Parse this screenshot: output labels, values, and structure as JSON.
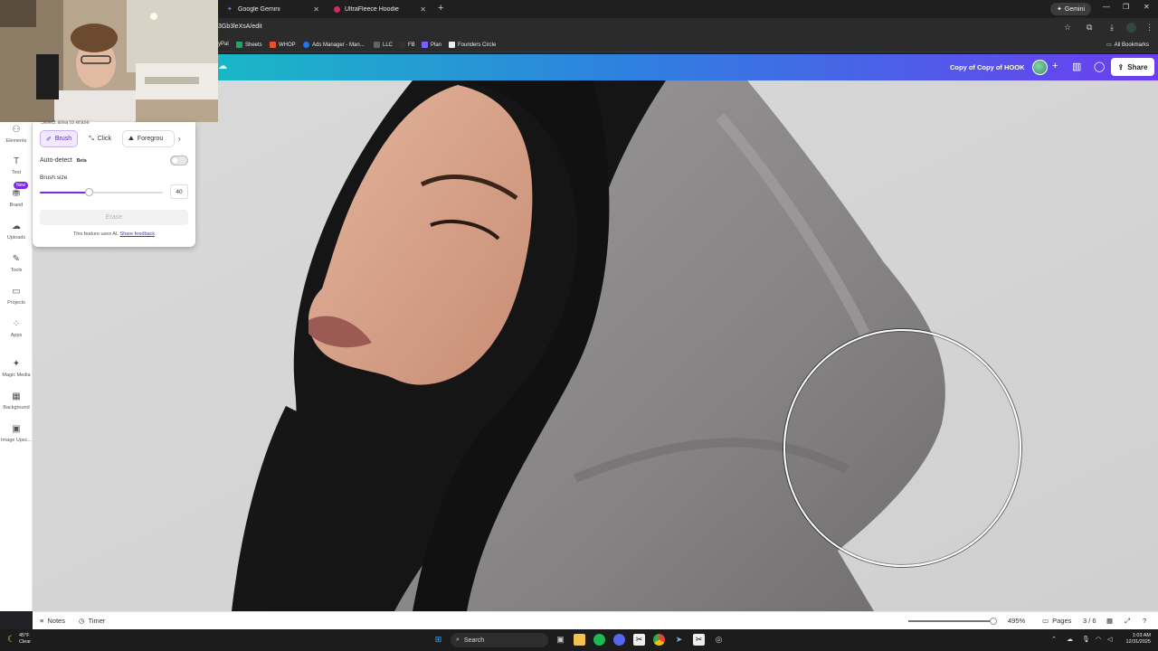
{
  "browser": {
    "tabs": [
      {
        "label": "Google Gemini",
        "favicon_color": "#4a8cf7"
      },
      {
        "label": "UltraFleece Hoodie",
        "favicon_color": "#e0245e"
      }
    ],
    "new_tab_symbol": "+",
    "gemini_button": "Gemini",
    "url": "3Gb3leXsA/edit",
    "bookmarks": [
      {
        "label": "yPal",
        "color": "#1f6fd1"
      },
      {
        "label": "Sheets",
        "color": "#1fa463"
      },
      {
        "label": "WHOP",
        "color": "#e8522f"
      },
      {
        "label": "Ads Manager - Man...",
        "color": "#1877f2"
      },
      {
        "label": "LLC",
        "color": "#5f6368"
      },
      {
        "label": "FB",
        "color": "#333333"
      },
      {
        "label": "Plan",
        "color": "#7b61ff"
      },
      {
        "label": "Founders Circle",
        "color": "#eeeeee"
      }
    ],
    "all_bookmarks": "All Bookmarks"
  },
  "canva": {
    "doc_title": "Copy of Copy of HOOK",
    "share_label": "Share",
    "gradient_start": "#1ab7c6",
    "gradient_end": "#6c3df0"
  },
  "siderail": {
    "items": [
      {
        "label": "Elements",
        "icon": "elements-icon",
        "glyph": "⚇"
      },
      {
        "label": "Text",
        "icon": "text-icon",
        "glyph": "T"
      },
      {
        "label": "Brand",
        "icon": "brand-icon",
        "glyph": "⛃"
      },
      {
        "label": "Uploads",
        "icon": "uploads-icon",
        "glyph": "☁"
      },
      {
        "label": "Tools",
        "icon": "tools-icon",
        "glyph": "✎"
      },
      {
        "label": "Projects",
        "icon": "projects-icon",
        "glyph": "▭"
      },
      {
        "label": "Apps",
        "icon": "apps-icon",
        "glyph": "⁘"
      },
      {
        "label": "Magic Media",
        "icon": "magic-media-icon",
        "glyph": "✦"
      },
      {
        "label": "Background",
        "icon": "background-icon",
        "glyph": "▦"
      },
      {
        "label": "Image Upsc...",
        "icon": "image-upscaler-icon",
        "glyph": "▣"
      }
    ],
    "new_badge": "New"
  },
  "eraser_panel": {
    "header": "Select area to erase",
    "modes": [
      {
        "label": "Brush",
        "active": true
      },
      {
        "label": "Click",
        "active": false
      },
      {
        "label": "Foregrou",
        "active": false
      }
    ],
    "auto_detect_label": "Auto-detect",
    "beta_label": "Beta",
    "auto_detect_on": false,
    "brush_size_label": "Brush size",
    "brush_size_value": "40",
    "brush_size_fraction": 0.4,
    "erase_label": "Erase",
    "ai_note": "This feature uses AI.",
    "feedback_link": "Share feedback",
    "accent_color": "#7d2ae8"
  },
  "bottombar": {
    "notes_label": "Notes",
    "timer_label": "Timer",
    "zoom_label": "495%",
    "zoom_fraction": 0.96,
    "pages_label": "Pages",
    "page_count": "3 / 6"
  },
  "taskbar": {
    "temperature": "45°F",
    "condition": "Clear",
    "search_placeholder": "Search",
    "time": "1:03 AM",
    "date": "12/31/2025"
  }
}
